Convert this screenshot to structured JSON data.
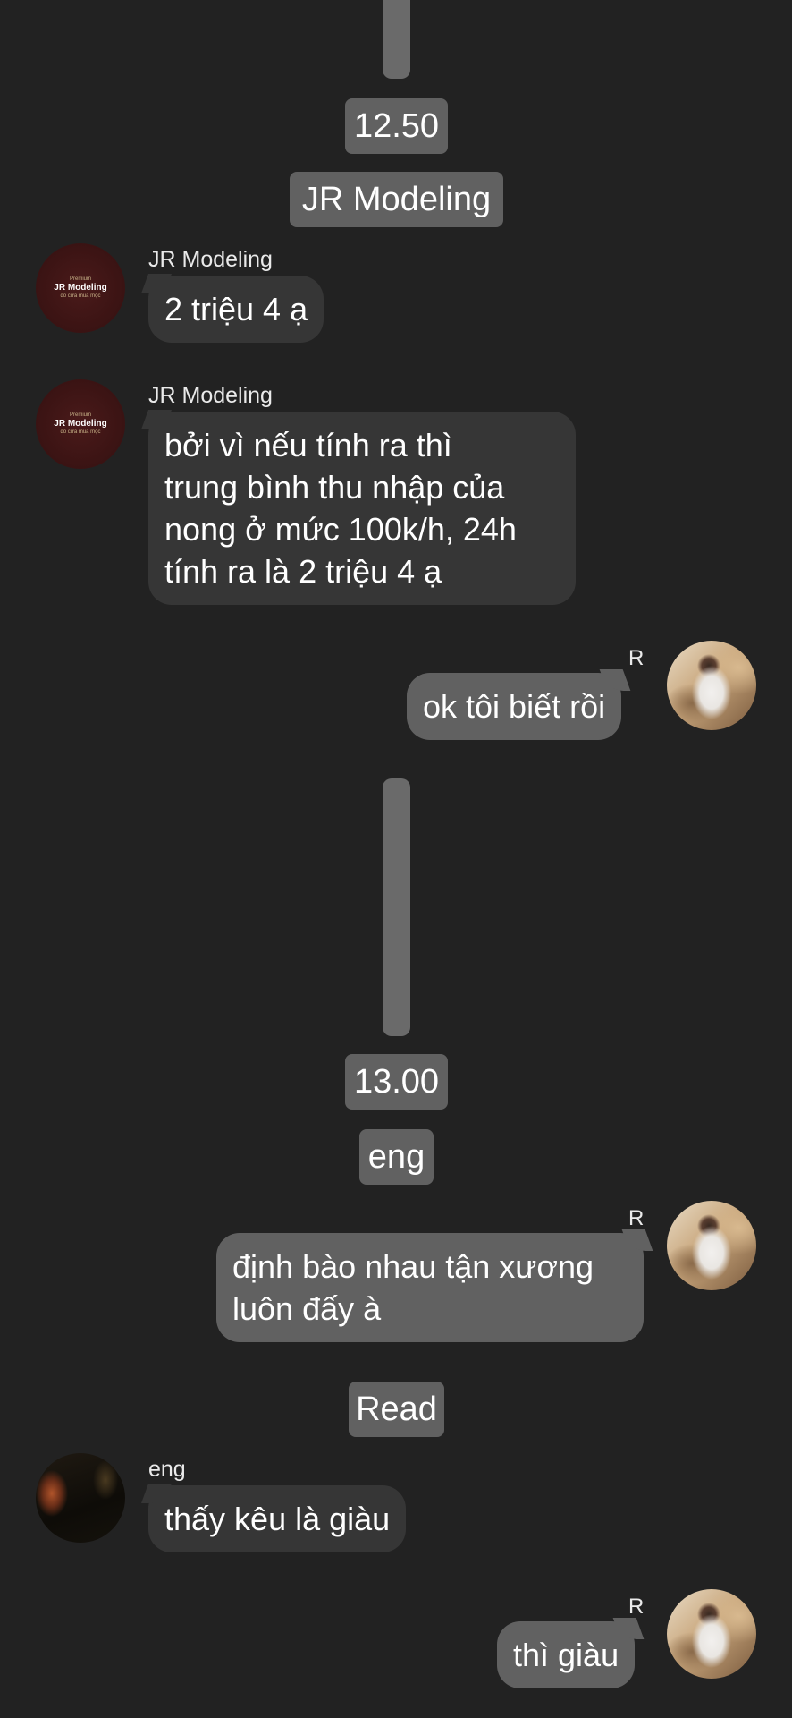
{
  "timestamps": {
    "first": "12.50",
    "second": "13.00"
  },
  "system_labels": {
    "group_name": "JR Modeling",
    "member_name": "eng",
    "read": "Read"
  },
  "avatars": {
    "brand_top_text": "Premium",
    "brand_name": "JR Modeling",
    "brand_bottom_text": "đồ cửa mua mộc"
  },
  "messages": [
    {
      "direction": "incoming",
      "sender": "JR Modeling",
      "lines": [
        "2 triệu 4 ạ"
      ]
    },
    {
      "direction": "incoming",
      "sender": "JR Modeling",
      "lines": [
        "bởi vì nếu tính ra thì",
        "trung bình thu nhập của",
        "nong ở mức 100k/h, 24h",
        "tính ra là 2 triệu 4 ạ"
      ]
    },
    {
      "direction": "outgoing",
      "initial": "R",
      "lines": [
        "ok tôi biết rồi"
      ]
    },
    {
      "direction": "outgoing",
      "initial": "R",
      "lines": [
        "định bào nhau tận xương",
        "luôn đấy à"
      ]
    },
    {
      "direction": "incoming",
      "sender": "eng",
      "lines": [
        "thấy kêu là giàu"
      ]
    },
    {
      "direction": "outgoing",
      "initial": "R",
      "lines": [
        "thì giàu"
      ]
    }
  ],
  "colors": {
    "background": "#222222",
    "incoming_bubble": "#363636",
    "outgoing_bubble": "#616161",
    "pill": "#616161",
    "gap_bar": "#6a6a6a"
  }
}
